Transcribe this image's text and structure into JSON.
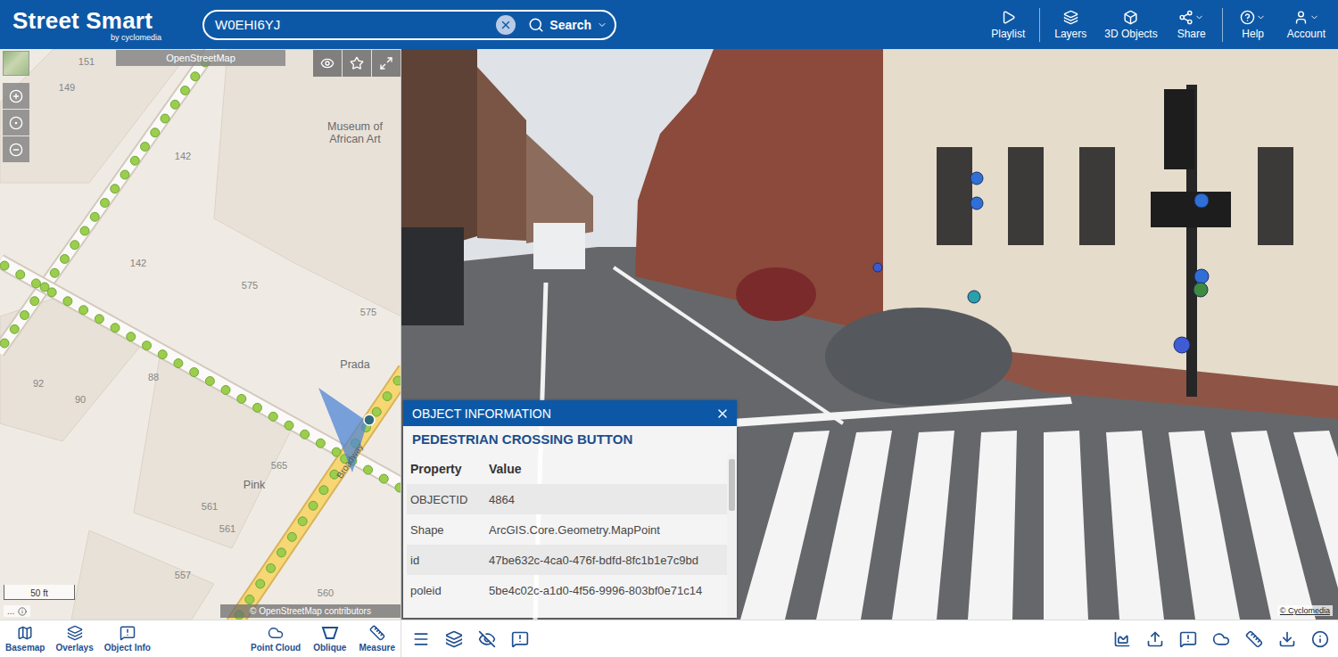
{
  "app": {
    "title": "Street Smart",
    "subtitle": "by cyclomedia"
  },
  "search": {
    "value": "W0EHI6YJ",
    "button": "Search"
  },
  "nav": [
    {
      "label": "Playlist",
      "dropdown": false
    },
    {
      "label": "Layers",
      "dropdown": false
    },
    {
      "label": "3D Objects",
      "dropdown": false
    },
    {
      "label": "Share",
      "dropdown": true
    },
    {
      "label": "Help",
      "dropdown": true
    },
    {
      "label": "Account",
      "dropdown": true
    }
  ],
  "map": {
    "source": "OpenStreetMap",
    "scale": "50 ft",
    "attribution": "© OpenStreetMap contributors",
    "more": "...",
    "labels": [
      "151",
      "149",
      "Museum of African Art",
      "142",
      "142",
      "575",
      "575",
      "Prada",
      "92",
      "90",
      "88",
      "565",
      "Pink",
      "561",
      "561",
      "557",
      "560"
    ],
    "streets": [
      "Broadway"
    ]
  },
  "map_toolbar": {
    "left": [
      "Basemap",
      "Overlays",
      "Object Info"
    ],
    "right": [
      "Point Cloud",
      "Oblique",
      "Measure"
    ]
  },
  "viewer": {
    "copyright": "© Cyclomedia"
  },
  "object_info": {
    "header": "OBJECT INFORMATION",
    "title": "PEDESTRIAN CROSSING BUTTON",
    "columns": [
      "Property",
      "Value"
    ],
    "rows": [
      {
        "property": "OBJECTID",
        "value": "4864"
      },
      {
        "property": "Shape",
        "value": "ArcGIS.Core.Geometry.MapPoint"
      },
      {
        "property": "id",
        "value": "47be632c-4ca0-476f-bdfd-8fc1b1e7c9bd"
      },
      {
        "property": "poleid",
        "value": "5be4c02c-a1d0-4f56-9996-803bf0e71c14"
      }
    ]
  }
}
